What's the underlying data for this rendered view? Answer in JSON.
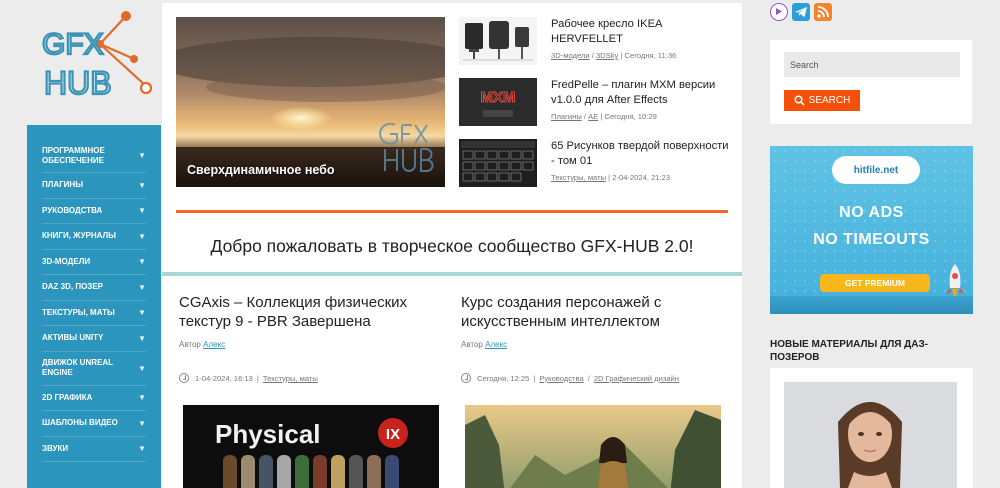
{
  "brand": {
    "line1": "GFX",
    "line2": "HUB"
  },
  "nav": {
    "items": [
      {
        "label": "Программное обеспечение"
      },
      {
        "label": "Плагины"
      },
      {
        "label": "Руководства"
      },
      {
        "label": "Книги, журналы"
      },
      {
        "label": "3D-модели"
      },
      {
        "label": "DAZ 3D, Позер"
      },
      {
        "label": "Текстуры, маты"
      },
      {
        "label": "Активы Unity"
      },
      {
        "label": "Движок Unreal Engine"
      },
      {
        "label": "2D Графика"
      },
      {
        "label": "Шаблоны видео"
      },
      {
        "label": "Звуки"
      }
    ],
    "arrow": "▼"
  },
  "hero": {
    "caption": "Сверхдинамичное небо"
  },
  "news": [
    {
      "title": "Рабочее кресло IKEA HERVFELLET",
      "cat1": "3D-модели",
      "cat2": "3DSky",
      "date": "Сегодня, 11:36"
    },
    {
      "title": "FredPelle – плагин MXM версии v1.0.0 для After Effects",
      "cat1": "Плагины",
      "cat2": "AE",
      "date": "Сегодня, 10:29",
      "thumb_text": "MXM"
    },
    {
      "title": "65 Рисунков твердой поверхности - том 01",
      "cat1": "Текстуры, маты",
      "cat2": "",
      "date": "2-04-2024, 21:23"
    }
  ],
  "sep": " / ",
  "bar": " | ",
  "welcome": "Добро пожаловать в творческое сообщество GFX-HUB 2.0!",
  "cards": [
    {
      "title": "CGAxis – Коллекция физических текстур 9 - PBR Завершена",
      "author_label": "Автор",
      "author": "Алекс",
      "date": "1-04-2024, 16:13",
      "cat1": "Текстуры, маты",
      "cat2": "",
      "image_text": "Physical"
    },
    {
      "title": "Курс создания персонажей с искусственным интеллектом",
      "author_label": "Автор",
      "author": "Алекс",
      "date": "Сегодня, 12:25",
      "cat1": "Руководства",
      "cat2": "2D Графический дизайн"
    }
  ],
  "search": {
    "placeholder": "Search",
    "button": "SEARCH"
  },
  "ad": {
    "brand": "hitfile.net",
    "line1": "NO ADS",
    "line2": "NO TIMEOUTS",
    "cta": "GET PREMIUM"
  },
  "daz_section": {
    "title": "Новые материалы для Даз-позеров"
  },
  "colors": {
    "accent": "#2b95bd",
    "orange": "#f26a21",
    "search_btn": "#f5500a",
    "teal_line": "#a7d6d6"
  }
}
